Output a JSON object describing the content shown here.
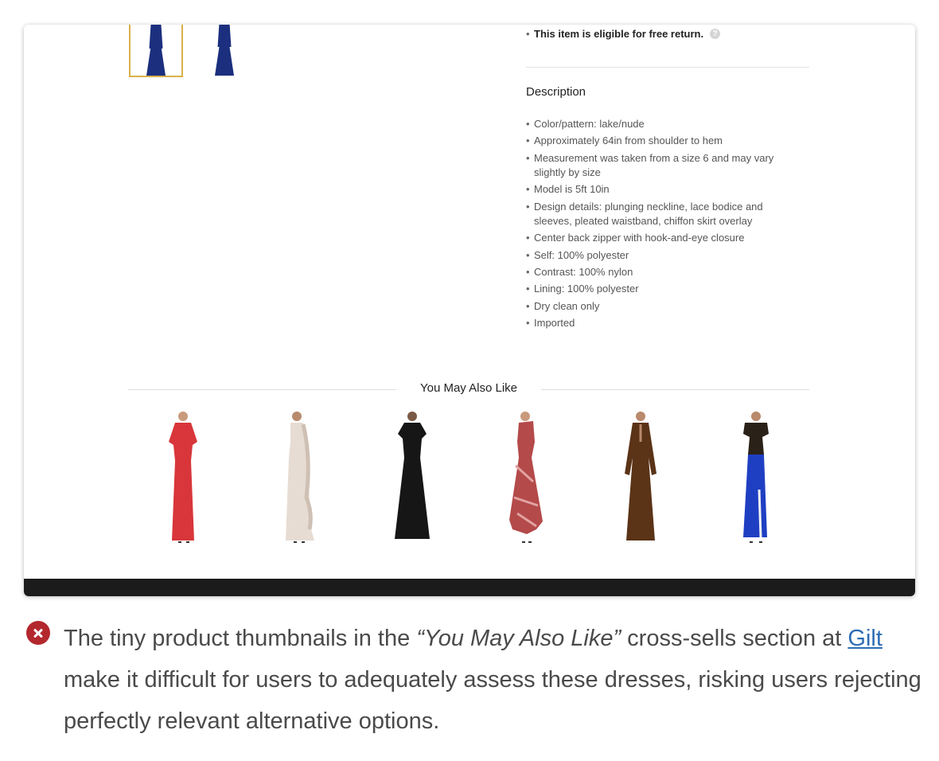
{
  "product": {
    "return_text": "This item is eligible for free return.",
    "help_icon": "question-circle-icon",
    "description_title": "Description",
    "description_items": [
      "Color/pattern: lake/nude",
      "Approximately 64in from shoulder to hem",
      "Measurement was taken from a size 6 and may vary slightly by size",
      "Model is 5ft 10in",
      "Design details: plunging neckline, lace bodice and sleeves, pleated waistband, chiffon skirt overlay",
      "Center back zipper with hook-and-eye closure",
      "Self: 100% polyester",
      "Contrast: 100% nylon",
      "Lining: 100% polyester",
      "Dry clean only",
      "Imported"
    ]
  },
  "recommendations": {
    "title": "You May Also Like",
    "items": [
      {
        "color": "#d8363a"
      },
      {
        "color": "#e7dcd3"
      },
      {
        "color": "#161616"
      },
      {
        "color": "#b44a4a"
      },
      {
        "color": "#5b3317"
      },
      {
        "color": "#1f3fc3"
      }
    ]
  },
  "colors": {
    "accent_thumb_border": "#d9b04a",
    "dress_navy": "#1c2f7e",
    "error_icon": "#b3282d",
    "link": "#2e6db4"
  },
  "caption": {
    "icon": "error-x-icon",
    "text_1": "The tiny product thumbnails in the ",
    "quote": "“You May Also Like”",
    "text_2": " cross-sells section at ",
    "link": "Gilt",
    "text_3": " make it difficult for users to adequately assess these dresses, risking users rejecting perfectly relevant alternative options."
  }
}
